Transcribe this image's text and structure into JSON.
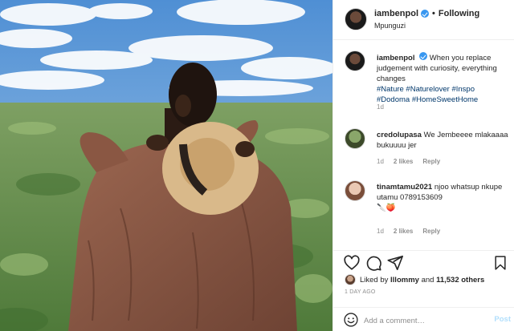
{
  "post": {
    "username": "iambenpol",
    "follow_label": "Following",
    "location": "Mpunguzi",
    "caption_text": "When you replace judgement with curiosity, everything changes",
    "caption_tags": "#Nature #Naturelover #Inspo #Dodoma #HomeSweetHome",
    "caption_time": "1d"
  },
  "comments": [
    {
      "username": "credolupasa",
      "text": "We Jembeeee mlakaaaa bukuuuu jer",
      "time": "1d",
      "likes": "2 likes",
      "reply": "Reply"
    },
    {
      "username": "tinamtamu2021",
      "text": "njoo whatsup nkupe utamu 0789153609",
      "emoji": "🔪🍑",
      "time": "1d",
      "likes": "2 likes",
      "reply": "Reply"
    }
  ],
  "likes": {
    "prefix": "Liked by",
    "user": "lllommy",
    "conjunction": "and",
    "others": "11,532 others"
  },
  "time_ago": "1 DAY AGO",
  "add_comment": {
    "placeholder": "Add a comment…",
    "post_label": "Post"
  },
  "icons": [
    "heart-icon",
    "comment-icon",
    "share-icon",
    "bookmark-icon",
    "smile-icon",
    "verified-icon"
  ],
  "colors": {
    "link": "#00376b",
    "verified": "#3897f0",
    "post_disabled": "#b2dffc",
    "muted": "#8e8e8e"
  }
}
